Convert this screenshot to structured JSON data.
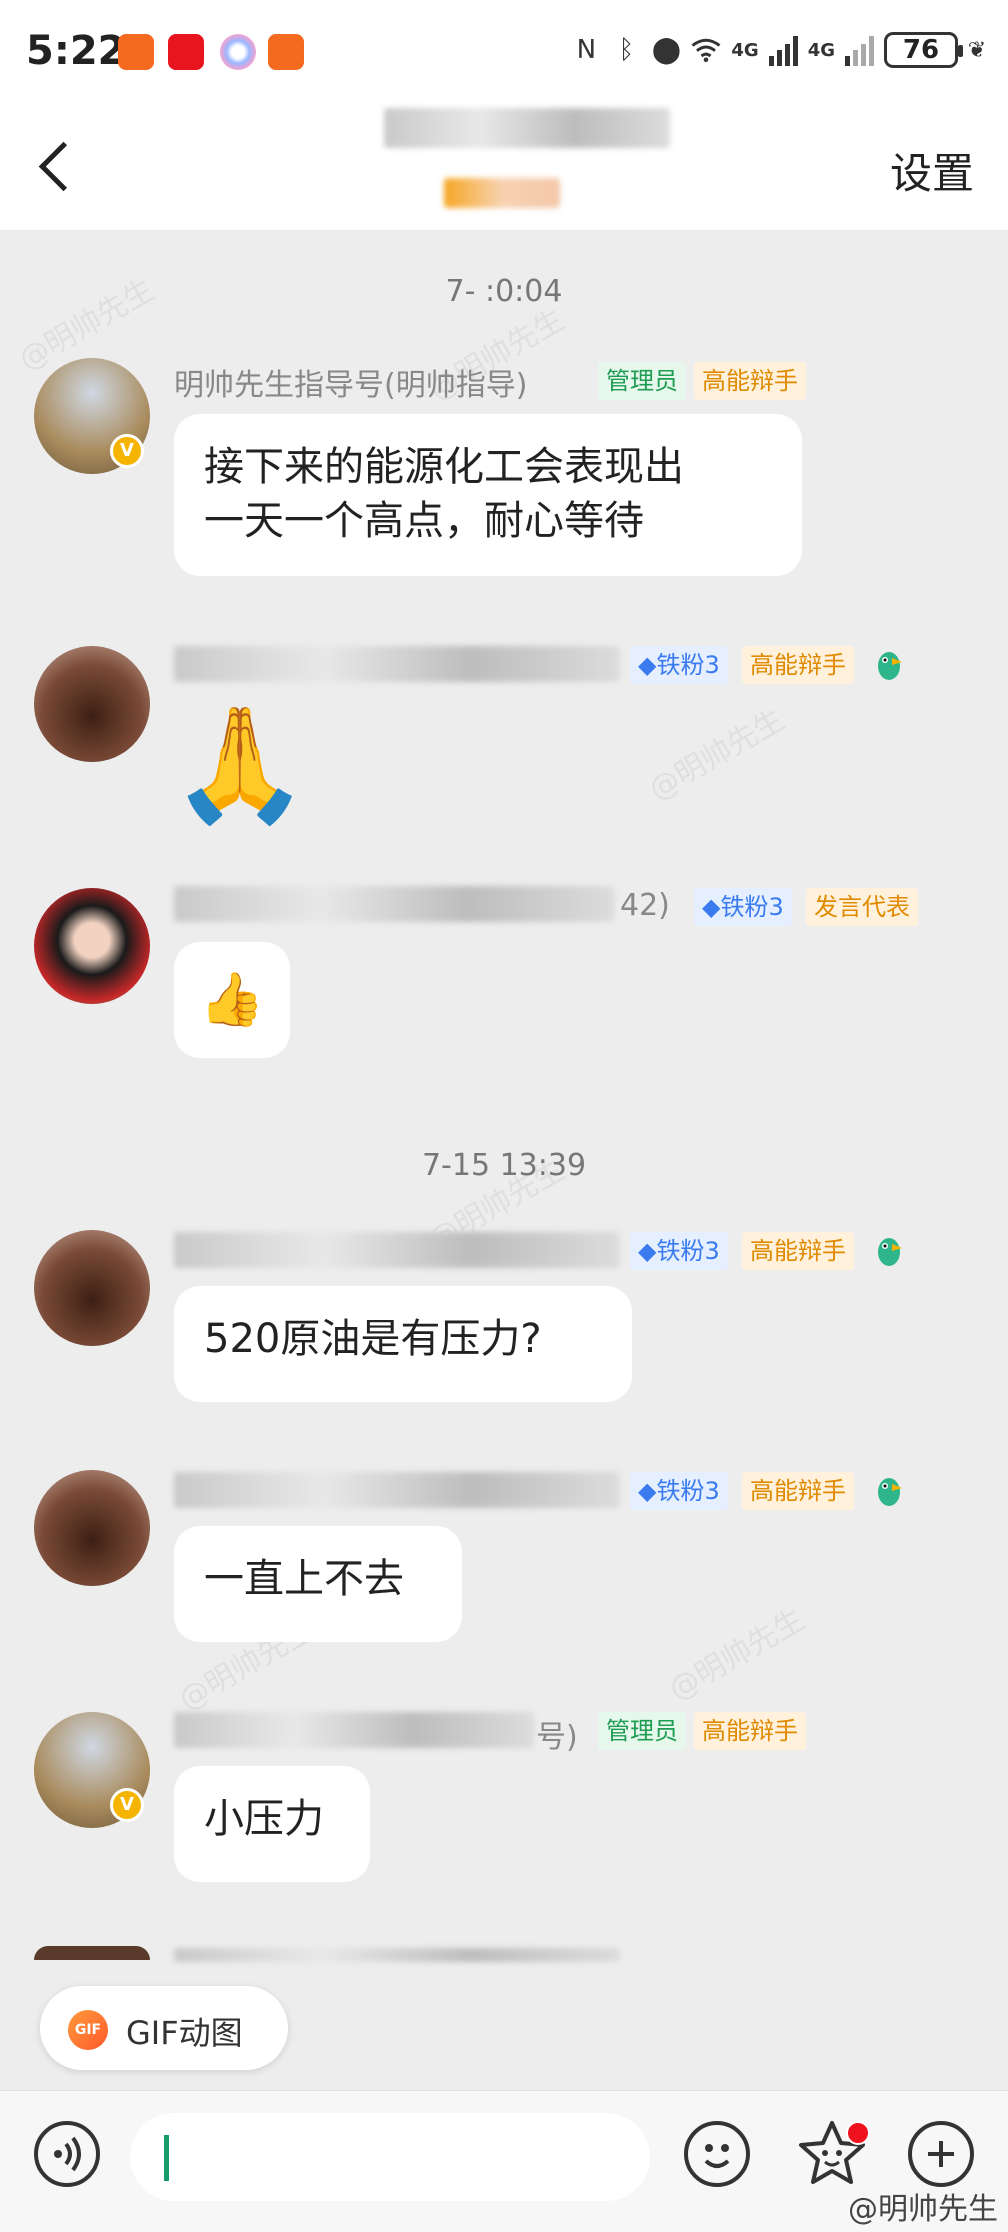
{
  "status_bar": {
    "time": "5:22",
    "network_1": "4G",
    "network_2": "4G",
    "battery": "76"
  },
  "header": {
    "settings_label": "设置"
  },
  "messages": [
    {
      "timestamp": "7-   :0:04",
      "sender": "明帅先生指导号(明帅指导)",
      "tags": [
        "管理员",
        "高能辩手"
      ],
      "text_lines": [
        "接下来的能源化工会表现出",
        "一天一个高点，耐心等待"
      ]
    },
    {
      "tags": [
        "铁粉3",
        "高能辩手"
      ],
      "emoji": "🙏"
    },
    {
      "sender_suffix": "42)",
      "tags": [
        "铁粉3",
        "发言代表"
      ],
      "emoji": "👍"
    },
    {
      "timestamp": "7-15 13:39",
      "tags": [
        "铁粉3",
        "高能辩手"
      ],
      "text": "520原油是有压力?"
    },
    {
      "tags": [
        "铁粉3",
        "高能辩手"
      ],
      "text": "一直上不去"
    },
    {
      "sender_suffix": "号)",
      "tags": [
        "管理员",
        "高能辩手"
      ],
      "text": "小压力"
    }
  ],
  "gif_chip": {
    "icon_text": "GIF",
    "label": "GIF动图"
  },
  "input_bar": {
    "placeholder": ""
  },
  "footer_watermark": "@明帅先生",
  "watermark": "@明帅先生",
  "colors": {
    "accent_green": "#169b6b",
    "tag_green": "#1e9c52",
    "tag_orange": "#e08a00",
    "tag_blue": "#3a7bf0",
    "chat_bg": "#ededed"
  }
}
